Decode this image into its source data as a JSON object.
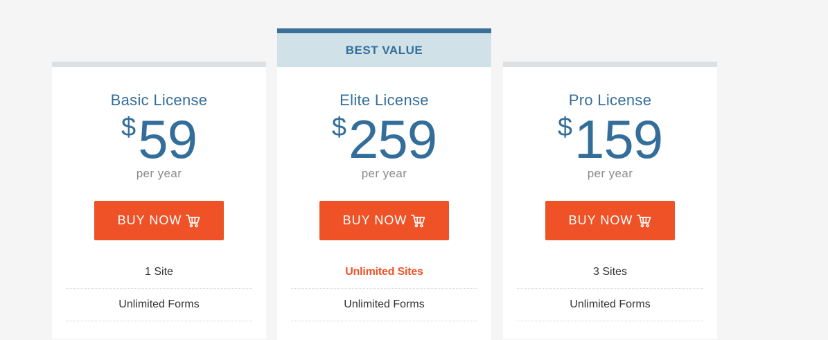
{
  "plans": [
    {
      "title": "Basic License",
      "currency": "$",
      "price": "59",
      "period": "per year",
      "button_label": "BUY NOW",
      "features": [
        "1 Site",
        "Unlimited Forms"
      ]
    },
    {
      "ribbon": "BEST VALUE",
      "title": "Elite License",
      "currency": "$",
      "price": "259",
      "period": "per year",
      "button_label": "BUY NOW",
      "features": [
        "Unlimited Sites",
        "Unlimited Forms"
      ]
    },
    {
      "title": "Pro License",
      "currency": "$",
      "price": "159",
      "period": "per year",
      "button_label": "BUY NOW",
      "features": [
        "3 Sites",
        "Unlimited Forms"
      ]
    }
  ],
  "colors": {
    "brand_blue": "#336e9a",
    "button_orange": "#ee5226",
    "ribbon_bg": "#d0e1e8",
    "muted_text": "#8a8a8a"
  },
  "icons": {
    "button": "shopping-cart-icon"
  }
}
